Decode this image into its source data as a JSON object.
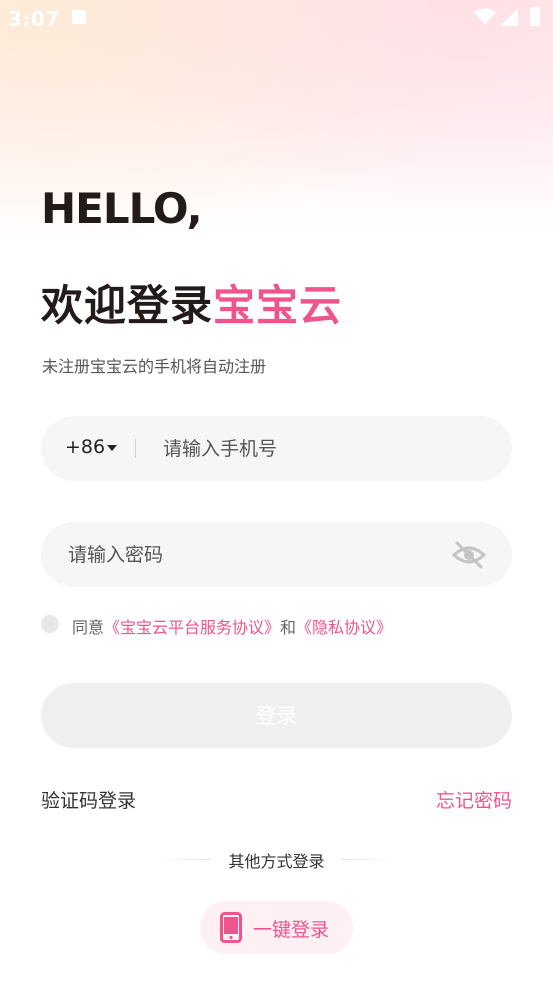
{
  "status_bar": {
    "time": "3:07",
    "icons": [
      "notification-icon",
      "wifi-icon",
      "signal-icon",
      "battery-icon"
    ]
  },
  "header": {
    "hello": "HELLO,",
    "welcome_prefix": "欢迎登录",
    "brand": "宝宝云",
    "subtitle": "未注册宝宝云的手机将自动注册"
  },
  "form": {
    "country_code": "+86",
    "phone_placeholder": "请输入手机号",
    "password_placeholder": "请输入密码",
    "agree_prefix": "同意",
    "service_link": "《宝宝云平台服务协议》",
    "agree_and": "和",
    "privacy_link": "《隐私协议》",
    "login_label": "登录"
  },
  "links": {
    "sms_login": "验证码登录",
    "forgot_password": "忘记密码"
  },
  "other": {
    "title": "其他方式登录",
    "one_key_label": "一键登录"
  },
  "colors": {
    "brand": "#f0548f",
    "text": "#231a1a",
    "field_bg": "#f6f6f6",
    "button_disabled": "#efefef"
  }
}
